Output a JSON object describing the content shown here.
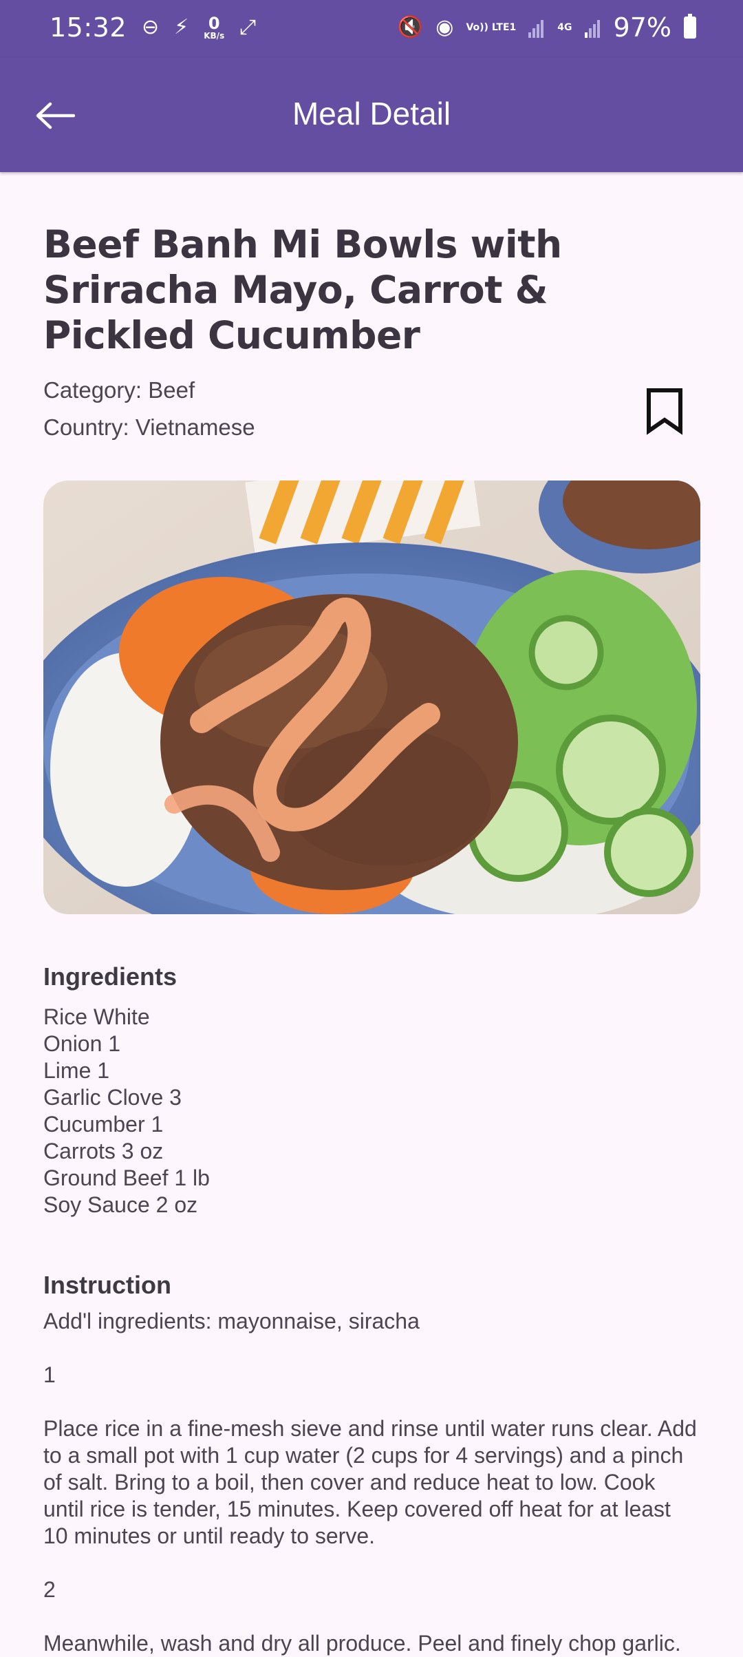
{
  "status_bar": {
    "time": "15:32",
    "kbs_value": "0",
    "kbs_unit": "KB/s",
    "volte": "Vo)) LTE1",
    "network": "4G",
    "battery": "97%"
  },
  "app_bar": {
    "back_icon": "arrow-left-icon",
    "title": "Meal Detail"
  },
  "meal": {
    "title": "Beef Banh Mi Bowls with Sriracha Mayo, Carrot & Pickled Cucumber",
    "category": "Category: Beef",
    "country": "Country: Vietnamese",
    "bookmark_icon": "bookmark-outline-icon",
    "image_icon": "meal-photo"
  },
  "ingredients": {
    "heading": "Ingredients",
    "items": [
      "Rice White",
      "Onion 1",
      "Lime 1",
      "Garlic Clove 3",
      "Cucumber 1",
      "Carrots 3 oz",
      "Ground Beef 1 lb",
      "Soy Sauce 2 oz"
    ]
  },
  "instruction": {
    "heading": "Instruction",
    "text": "Add'l ingredients: mayonnaise, siracha\n\n1\n\nPlace rice in a fine-mesh sieve and rinse until water runs clear. Add to a small pot with 1 cup water (2 cups for 4 servings) and a pinch of salt. Bring to a boil, then cover and reduce heat to low. Cook until rice is tender, 15 minutes. Keep covered off heat for at least 10 minutes or until ready to serve.\n\n2\n\nMeanwhile, wash and dry all produce. Peel and finely chop garlic."
  },
  "colors": {
    "primary": "#634ea1",
    "background": "#fdf7fd",
    "text": "#3a3540"
  }
}
